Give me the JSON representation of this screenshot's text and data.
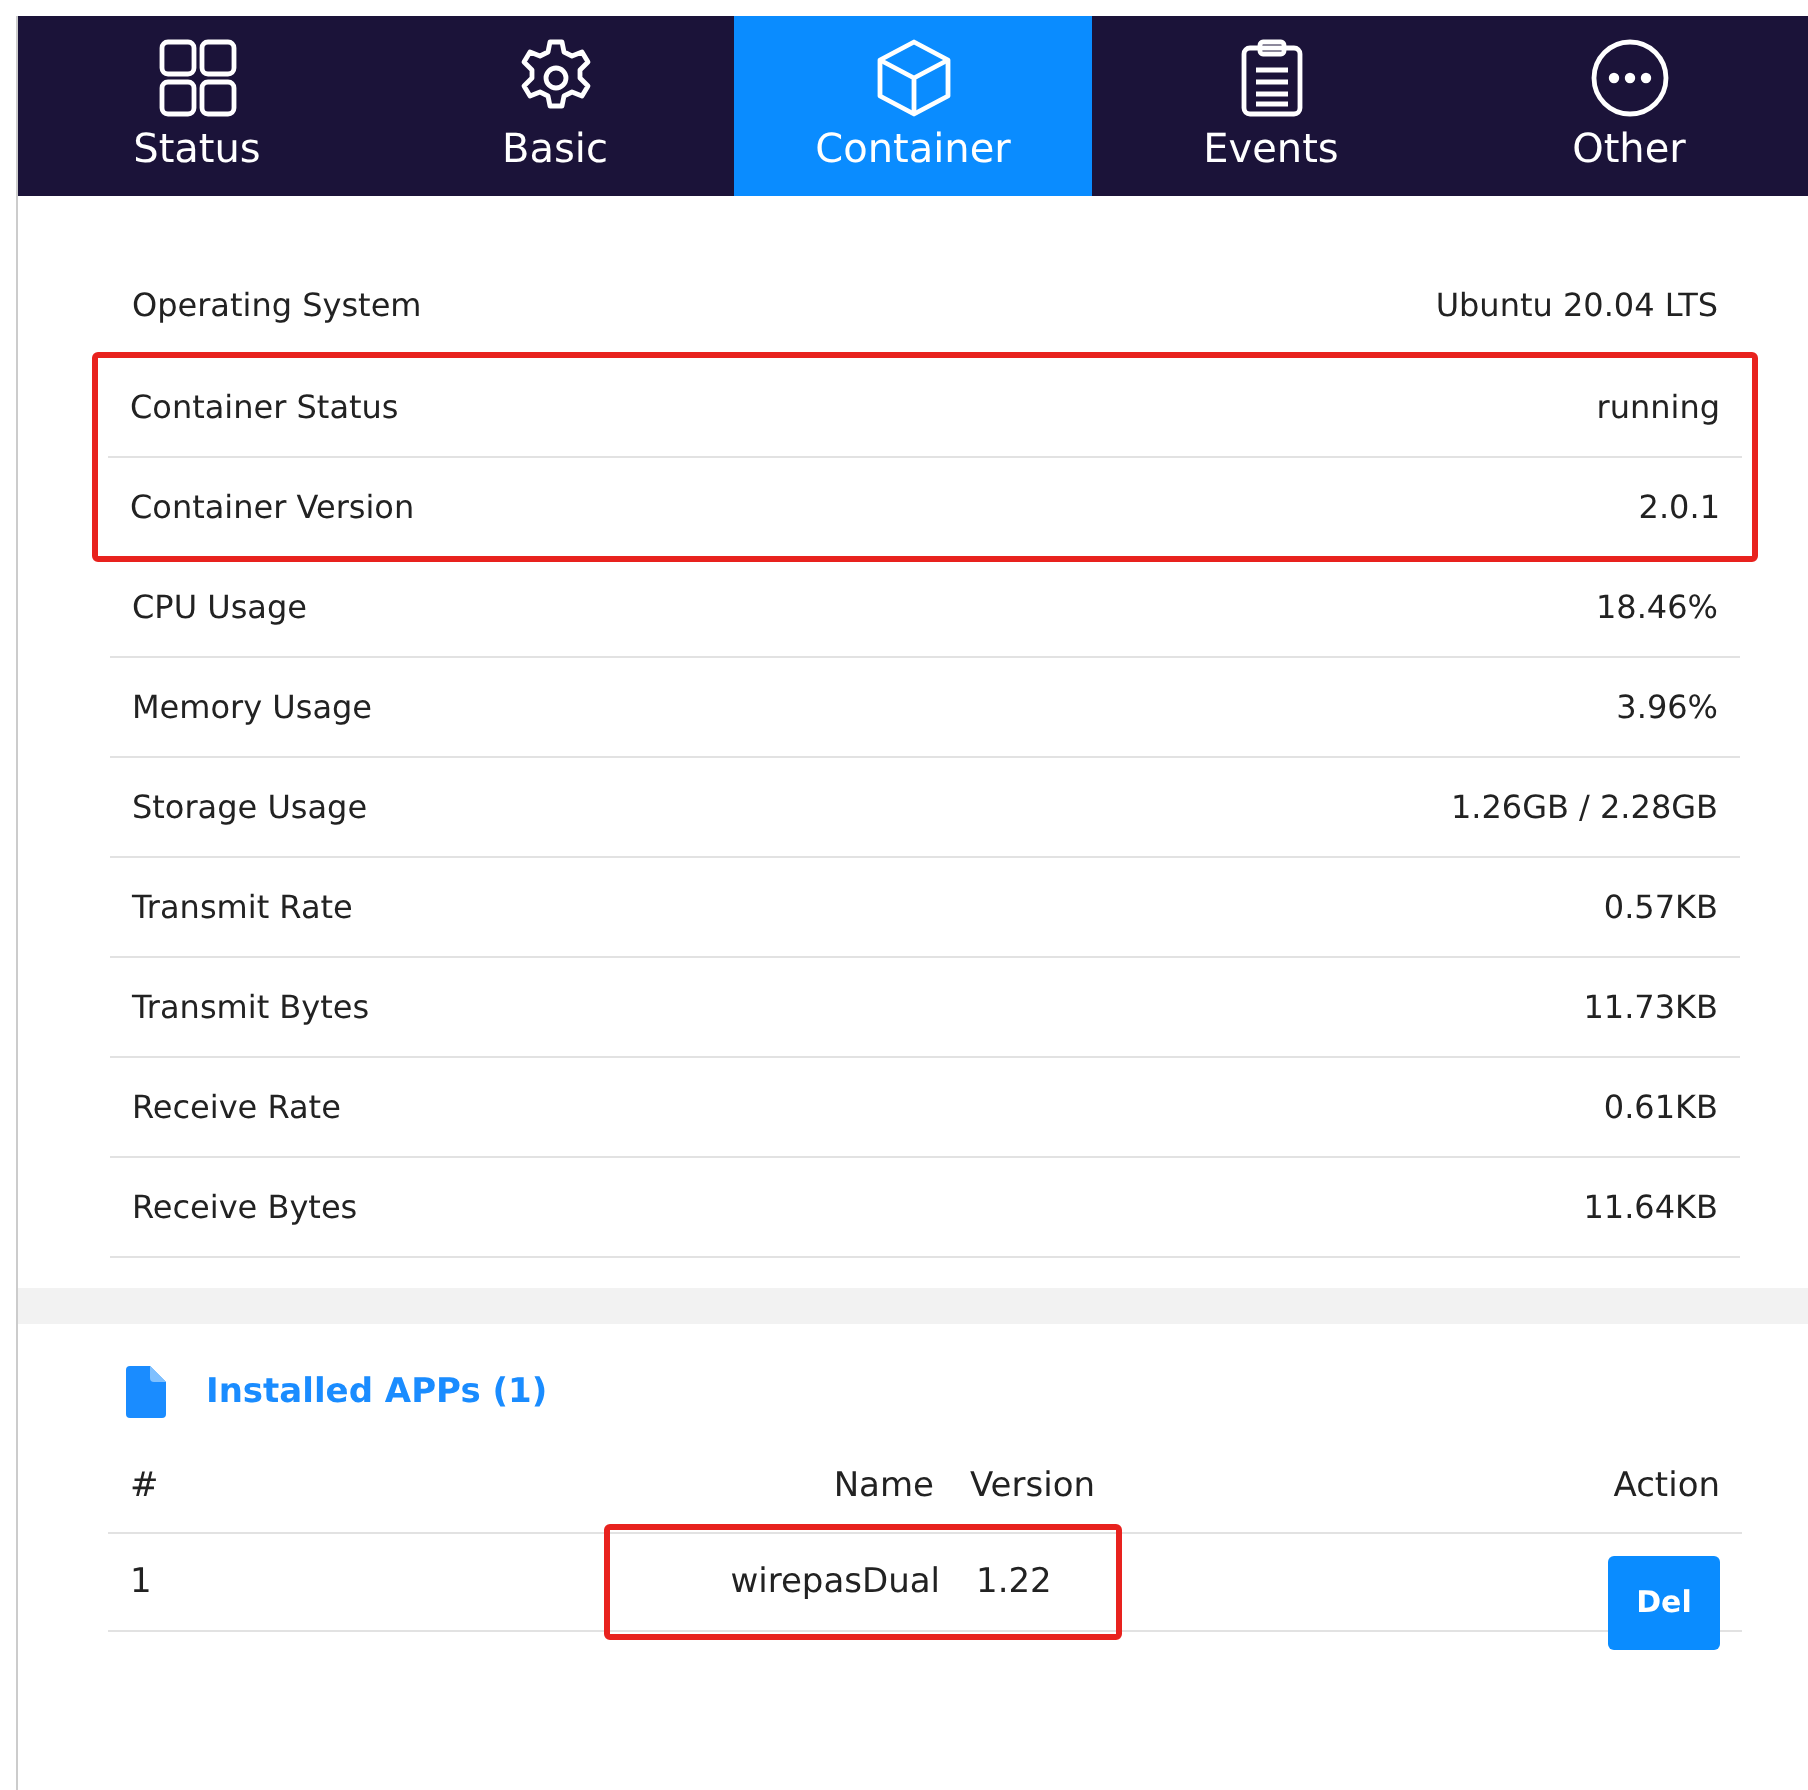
{
  "tabs": [
    {
      "label": "Status",
      "selected": false
    },
    {
      "label": "Basic",
      "selected": false
    },
    {
      "label": "Container",
      "selected": true
    },
    {
      "label": "Events",
      "selected": false
    },
    {
      "label": "Other",
      "selected": false
    }
  ],
  "info_rows": [
    {
      "label": "Operating System",
      "value": "Ubuntu 20.04 LTS",
      "highlighted": false
    },
    {
      "label": "Container Status",
      "value": "running",
      "highlighted": true
    },
    {
      "label": "Container Version",
      "value": "2.0.1",
      "highlighted": true
    },
    {
      "label": "CPU Usage",
      "value": "18.46%",
      "highlighted": false
    },
    {
      "label": "Memory Usage",
      "value": "3.96%",
      "highlighted": false
    },
    {
      "label": "Storage Usage",
      "value": "1.26GB / 2.28GB",
      "highlighted": false
    },
    {
      "label": "Transmit Rate",
      "value": "0.57KB",
      "highlighted": false
    },
    {
      "label": "Transmit Bytes",
      "value": "11.73KB",
      "highlighted": false
    },
    {
      "label": "Receive Rate",
      "value": "0.61KB",
      "highlighted": false
    },
    {
      "label": "Receive Bytes",
      "value": "11.64KB",
      "highlighted": false
    }
  ],
  "apps": {
    "title": "Installed APPs (1)",
    "columns": [
      "#",
      "Name",
      "Version",
      "Action"
    ],
    "rows": [
      {
        "index": "1",
        "name": "wirepasDual",
        "version": "1.22",
        "action": "Del",
        "highlighted": true
      }
    ]
  }
}
